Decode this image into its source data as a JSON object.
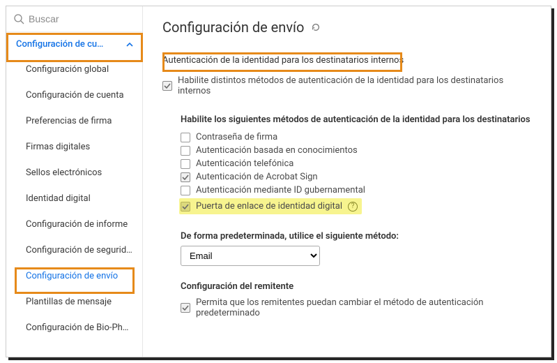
{
  "search": {
    "placeholder": "Buscar"
  },
  "sidebar": {
    "section_label": "Configuración de cu…",
    "items": [
      {
        "label": "Configuración global"
      },
      {
        "label": "Configuración de cuenta"
      },
      {
        "label": "Preferencias de firma"
      },
      {
        "label": "Firmas digitales"
      },
      {
        "label": "Sellos electrónicos"
      },
      {
        "label": "Identidad digital"
      },
      {
        "label": "Configuración de informe"
      },
      {
        "label": "Configuración de segurid…"
      },
      {
        "label": "Configuración de envío",
        "active": true
      },
      {
        "label": "Plantillas de mensaje"
      },
      {
        "label": "Configuración de Bio-Ph…"
      }
    ]
  },
  "main": {
    "title": "Configuración de envío",
    "auth_section": {
      "title": "Autenticación de la identidad para los destinatarios internos",
      "enable_label": "Habilite distintos métodos de autenticación de la identidad para los destinatarios internos",
      "enable_checked": true,
      "methods_label": "Habilite los siguientes métodos de autenticación de la identidad para los destinatarios",
      "methods": [
        {
          "label": "Contraseña de firma",
          "checked": false
        },
        {
          "label": "Autenticación basada en conocimientos",
          "checked": false
        },
        {
          "label": "Autenticación telefónica",
          "checked": false
        },
        {
          "label": "Autenticación de Acrobat Sign",
          "checked": true
        },
        {
          "label": "Autenticación mediante ID gubernamental",
          "checked": false
        },
        {
          "label": "Puerta de enlace de identidad digital",
          "checked": true,
          "highlight": true,
          "info": true
        }
      ],
      "default_label": "De forma predeterminada, utilice el siguiente método:",
      "default_value": "Email",
      "sender_section_label": "Configuración del remitente",
      "sender_option_label": "Permita que los remitentes puedan cambiar el método de autenticación predeterminado",
      "sender_option_checked": true
    }
  }
}
